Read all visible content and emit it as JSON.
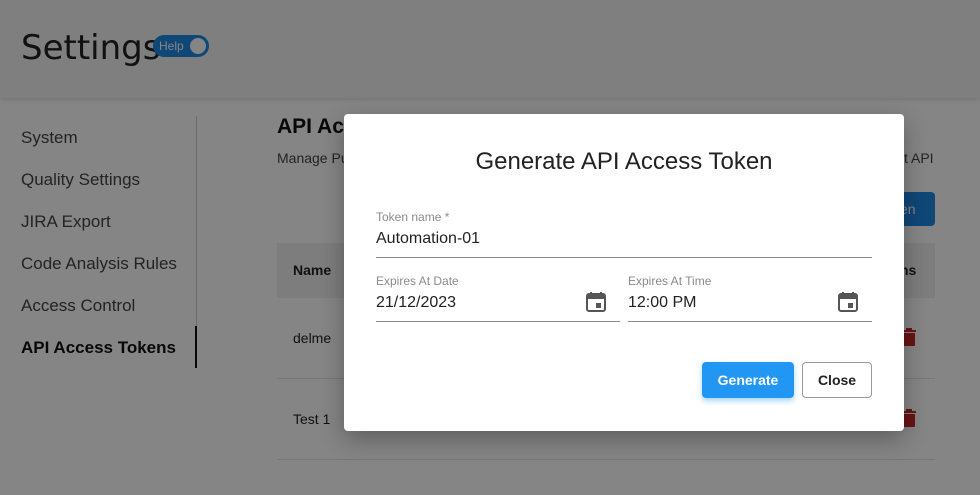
{
  "header": {
    "title": "Settings",
    "help_label": "Help"
  },
  "sidebar": {
    "items": [
      {
        "label": "System"
      },
      {
        "label": "Quality Settings"
      },
      {
        "label": "JIRA Export"
      },
      {
        "label": "Code Analysis Rules"
      },
      {
        "label": "Access Control"
      },
      {
        "label": "API Access Tokens",
        "active": true
      }
    ]
  },
  "main": {
    "title_visible": "API Ac",
    "description_visible": "Manage Pu",
    "description_tail_visible": "t API",
    "new_token_button_visible": "en",
    "table": {
      "columns": [
        "Name",
        "ns"
      ],
      "rows": [
        {
          "name": "delme"
        },
        {
          "name": "Test 1"
        }
      ]
    }
  },
  "dialog": {
    "title": "Generate API Access Token",
    "token_name": {
      "label": "Token name *",
      "value": "Automation-01"
    },
    "expires_date": {
      "label": "Expires At Date",
      "value": "21/12/2023"
    },
    "expires_time": {
      "label": "Expires At Time",
      "value": "12:00 PM"
    },
    "generate_label": "Generate",
    "close_label": "Close"
  },
  "colors": {
    "primary": "#2196f3",
    "toggle": "#1e88e5",
    "danger": "#c62828"
  },
  "icons": {
    "calendar": "calendar-icon",
    "delete": "trash-icon"
  }
}
